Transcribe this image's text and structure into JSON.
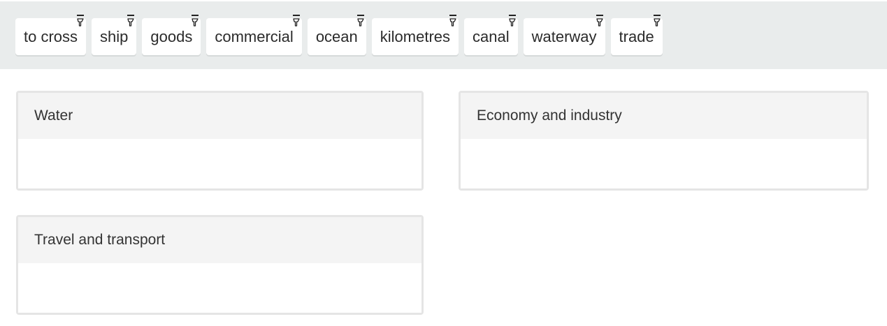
{
  "word_pool": {
    "words": [
      {
        "label": "to cross",
        "icon": "drag-handle-icon"
      },
      {
        "label": "ship",
        "icon": "drag-handle-icon"
      },
      {
        "label": "goods",
        "icon": "drag-handle-icon"
      },
      {
        "label": "commercial",
        "icon": "drag-handle-icon"
      },
      {
        "label": "ocean",
        "icon": "drag-handle-icon"
      },
      {
        "label": "kilometres",
        "icon": "drag-handle-icon"
      },
      {
        "label": "canal",
        "icon": "drag-handle-icon"
      },
      {
        "label": "waterway",
        "icon": "drag-handle-icon"
      },
      {
        "label": "trade",
        "icon": "drag-handle-icon"
      }
    ]
  },
  "drop_zones": [
    {
      "title": "Water",
      "items": []
    },
    {
      "title": "Economy and industry",
      "items": []
    },
    {
      "title": "Travel and transport",
      "items": []
    }
  ],
  "colors": {
    "pool_background": "#e9ecec",
    "zone_header_background": "#f4f4f4",
    "zone_border": "#e5e5e5"
  }
}
